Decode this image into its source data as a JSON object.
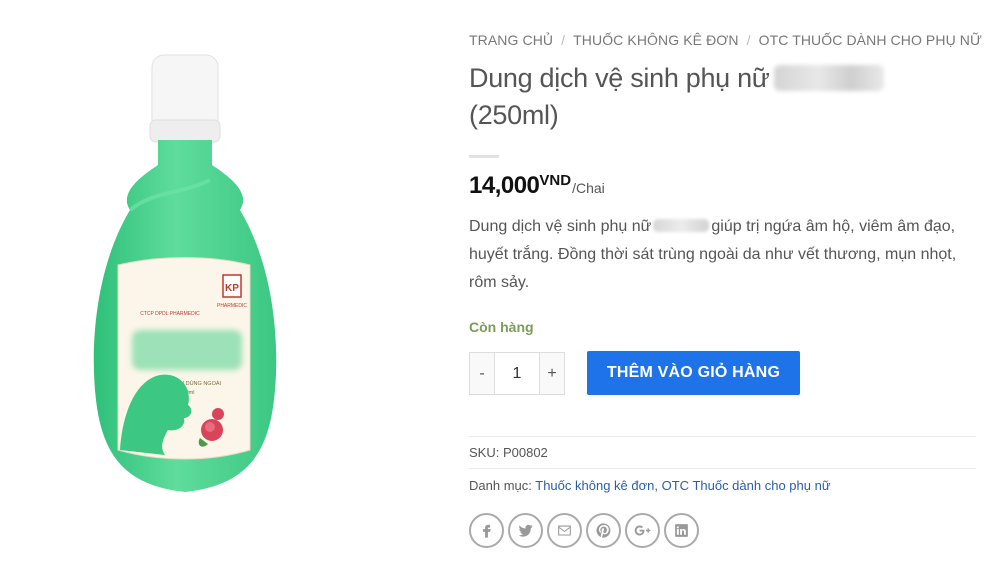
{
  "breadcrumb": {
    "items": [
      "TRANG CHỦ",
      "THUỐC KHÔNG KÊ ĐƠN",
      "OTC THUỐC DÀNH CHO PHỤ NỮ"
    ],
    "separator": "/"
  },
  "product": {
    "title_line1": "Dung dịch vệ sinh phụ nữ",
    "title_line2": "(250ml)",
    "price_amount": "14,000",
    "price_currency": "VND",
    "price_unit": "/Chai",
    "desc_before": "Dung dịch vệ sinh phụ nữ",
    "desc_after": "giúp trị ngứa âm hộ, viêm âm đạo, huyết trắng. Đồng thời sát trùng ngoài da như vết thương, mụn nhọt, rôm sảy.",
    "stock": "Còn hàng"
  },
  "image": {
    "label_brand": "PHARMEDIC",
    "label_company": "CTCP DPDL PHARMEDIC",
    "label_usage": "DUNG DỊCH DÙNG NGOÀI",
    "label_volume": "250ml",
    "logo_letters": "K P",
    "bottle_color": "#4fd08f",
    "cap_color": "#f4f4f4"
  },
  "cart": {
    "minus": "-",
    "plus": "+",
    "quantity": "1",
    "add_label": "THÊM VÀO GIỎ HÀNG",
    "button_color": "#1e73e8"
  },
  "meta": {
    "sku_label": "SKU:",
    "sku_value": "P00802",
    "category_label": "Danh mục:",
    "category_1": "Thuốc không kê đơn",
    "category_sep": ",",
    "category_2": "OTC Thuốc dành cho phụ nữ"
  },
  "share": {
    "icons": [
      "facebook-icon",
      "twitter-icon",
      "email-icon",
      "pinterest-icon",
      "google-plus-icon",
      "linkedin-icon"
    ]
  }
}
